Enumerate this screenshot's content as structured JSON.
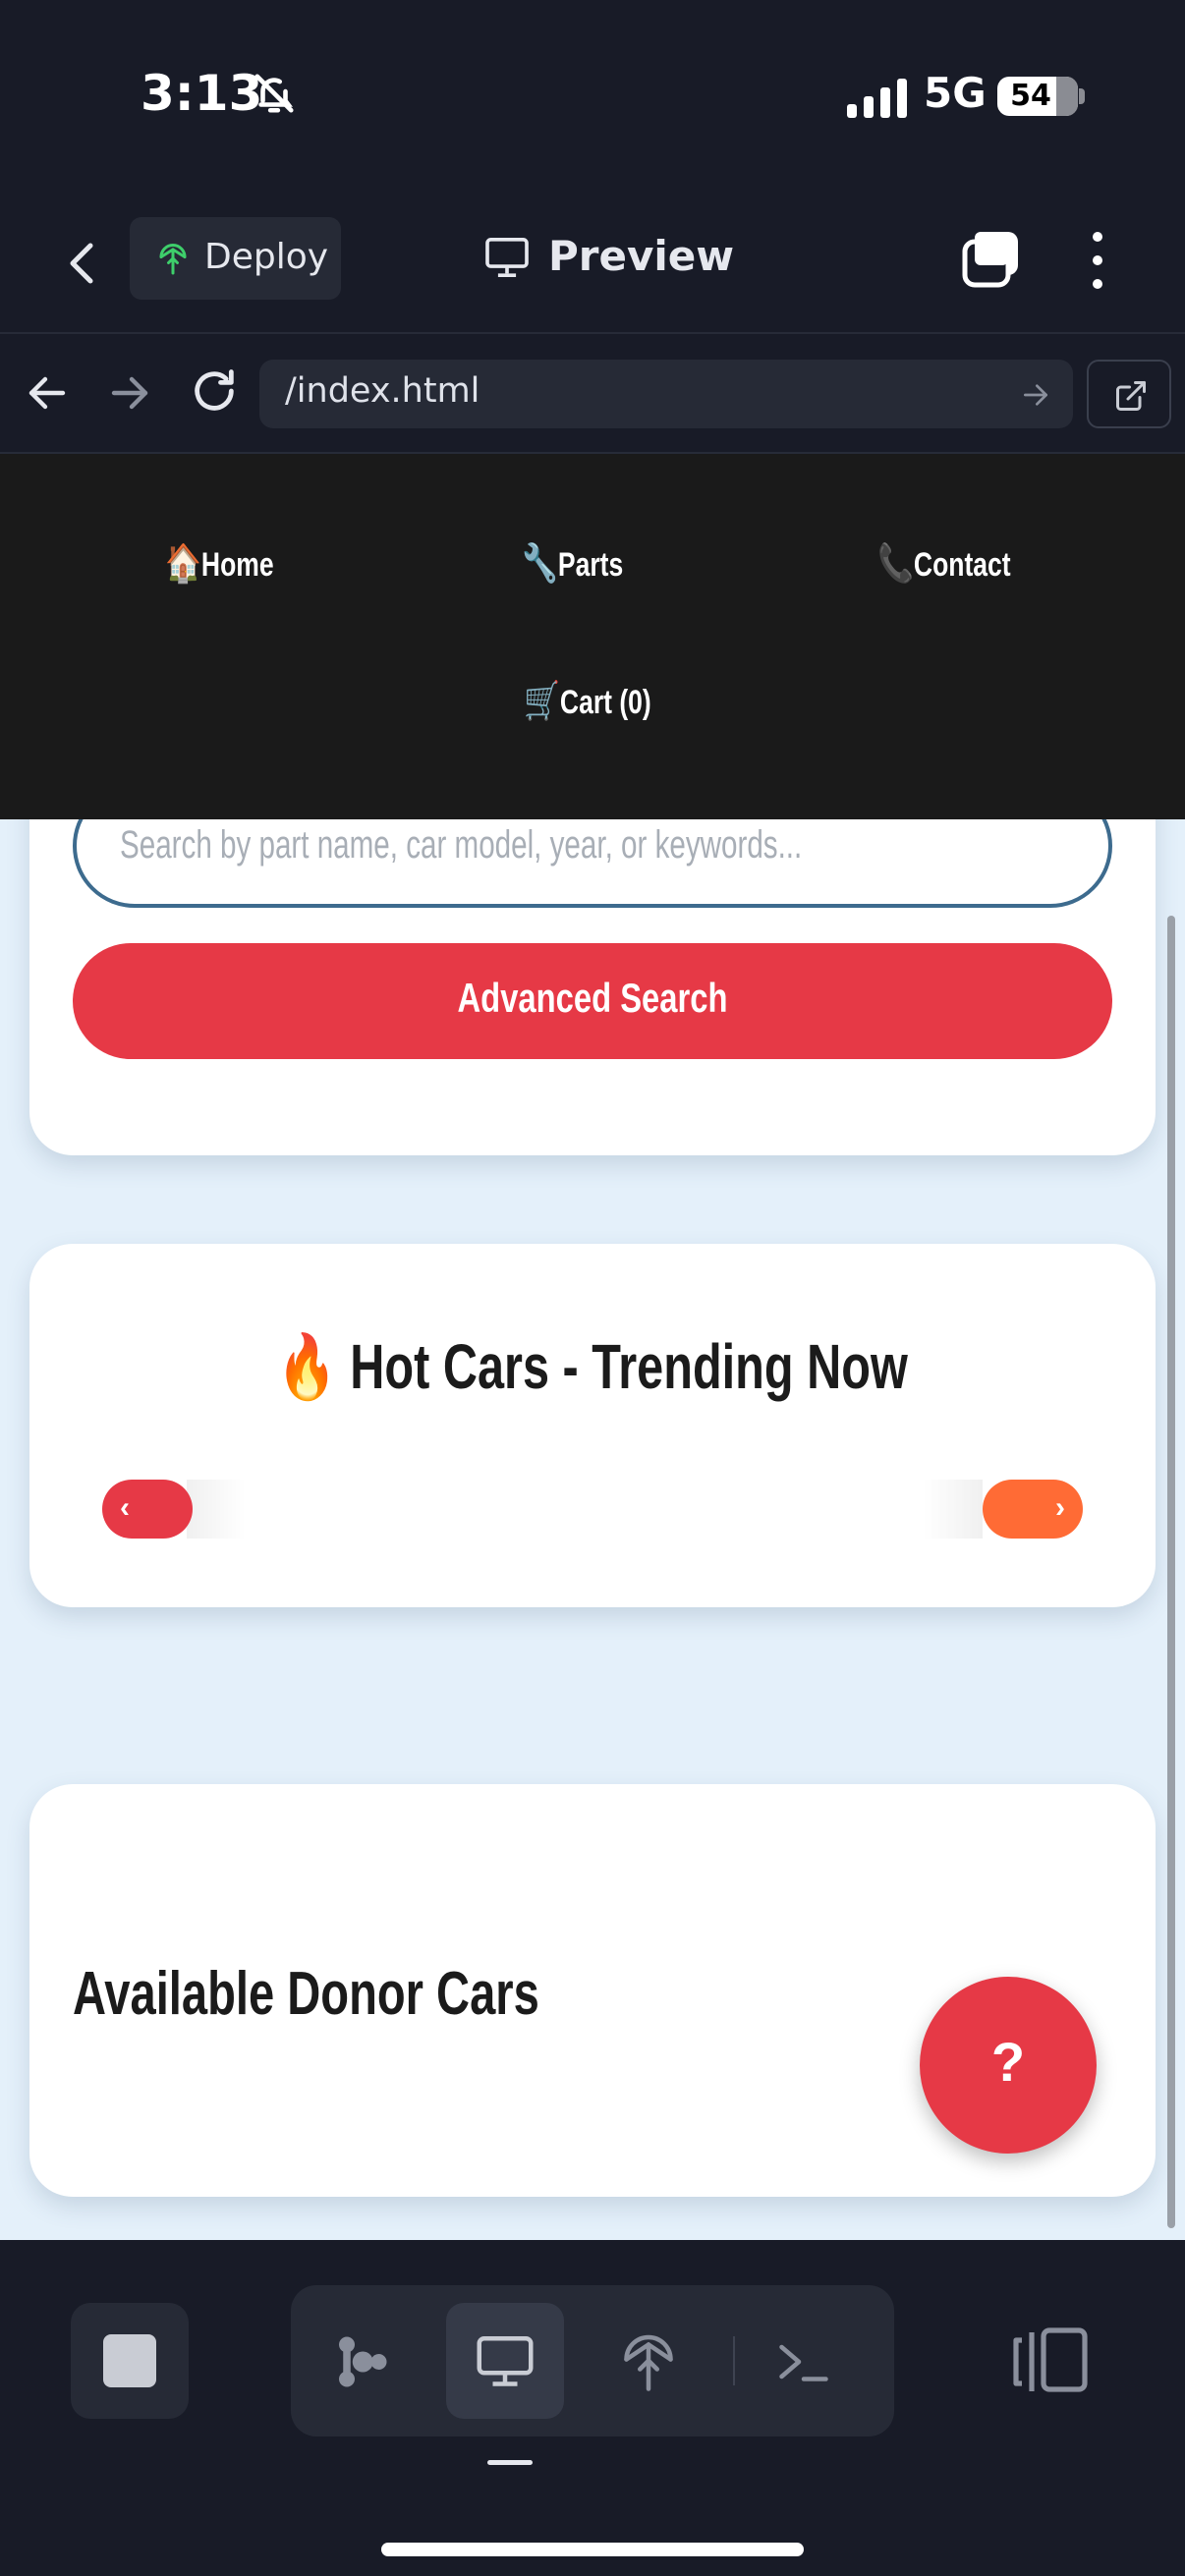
{
  "status_bar": {
    "time": "3:13",
    "network": "5G",
    "battery": "54"
  },
  "app_header": {
    "deploy_label": "Deploy",
    "preview_label": "Preview"
  },
  "browser": {
    "url": "/index.html"
  },
  "site": {
    "nav": [
      {
        "emoji": "🏠",
        "label": "Home"
      },
      {
        "emoji": "🔧",
        "label": "Parts"
      },
      {
        "emoji": "📞",
        "label": "Contact"
      },
      {
        "emoji": "🛒",
        "label": "Cart (0)"
      }
    ],
    "search": {
      "placeholder": "Search by part name, car model, year, or keywords...",
      "advanced_button": "Advanced Search"
    },
    "hot_cars": {
      "title": "🔥 Hot Cars - Trending Now",
      "prev": "‹",
      "next": "›"
    },
    "donor": {
      "title": "Available Donor Cars"
    },
    "help_button": "?"
  },
  "colors": {
    "accent_red": "#e63946",
    "accent_orange": "#ff6b35",
    "nav_bg": "#1a1a1a",
    "page_bg": "#e4f0fa",
    "app_bg": "#181b27"
  },
  "icons": {
    "status": [
      "bell-slash-icon",
      "signal-icon",
      "battery-icon"
    ],
    "header": [
      "chevron-left-icon",
      "deploy-icon",
      "monitor-icon",
      "tabs-icon",
      "more-vertical-icon"
    ],
    "browser": [
      "arrow-left-icon",
      "arrow-right-icon",
      "reload-icon",
      "go-arrow-icon",
      "open-external-icon"
    ],
    "toolbar": [
      "stop-icon",
      "agent-icon",
      "monitor-icon",
      "deploy-icon",
      "terminal-icon",
      "layout-icon"
    ]
  }
}
